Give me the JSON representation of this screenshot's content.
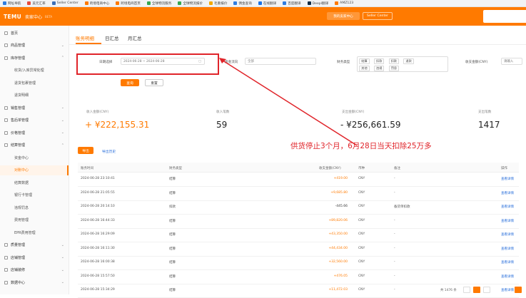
{
  "bookmarks": [
    "网址导航",
    "美元汇率",
    "Seller Center",
    "跨境电商中心",
    "跨境电商首页",
    "全球物流服务",
    "全球物流报价",
    "毛重报价",
    "佣金查询",
    "在线翻译",
    "百度翻译",
    "Deepl翻译",
    "AMZ123"
  ],
  "topbar": {
    "logo": "TEMU",
    "subtitle": "卖家中心",
    "tag": "BETA",
    "btn_a": "我的卖家中心",
    "btn_b": "Seller Center"
  },
  "sidebar": {
    "items": [
      {
        "label": "首页",
        "level": 0,
        "chev": ""
      },
      {
        "label": "商品管理",
        "level": 0,
        "chev": "⌄"
      },
      {
        "label": "库存管理",
        "level": 0,
        "chev": "⌃"
      },
      {
        "label": "收货/入库异常处理",
        "level": 1,
        "chev": ""
      },
      {
        "label": "退货包裹管理",
        "level": 1,
        "chev": ""
      },
      {
        "label": "退货明细",
        "level": 1,
        "chev": ""
      },
      {
        "label": "销售管理",
        "level": 0,
        "chev": "⌄"
      },
      {
        "label": "售后单管理",
        "level": 0,
        "chev": "⌄"
      },
      {
        "label": "价格管理",
        "level": 0,
        "chev": "⌄"
      },
      {
        "label": "结算管理",
        "level": 0,
        "chev": "⌃"
      },
      {
        "label": "资金中心",
        "level": 1,
        "chev": ""
      },
      {
        "label": "对账中心",
        "level": 1,
        "chev": "",
        "active": true
      },
      {
        "label": "结算数据",
        "level": 1,
        "chev": ""
      },
      {
        "label": "银行卡管理",
        "level": 1,
        "chev": ""
      },
      {
        "label": "违规罚息",
        "level": 1,
        "chev": ""
      },
      {
        "label": "费用管理",
        "level": 1,
        "chev": ""
      },
      {
        "label": "EPR费用管理",
        "level": 1,
        "chev": ""
      },
      {
        "label": "质量管理",
        "level": 0,
        "chev": "⌄"
      },
      {
        "label": "店铺管理",
        "level": 0,
        "chev": "⌄"
      },
      {
        "label": "店铺装修",
        "level": 0,
        "chev": "⌄"
      },
      {
        "label": "数据中心",
        "level": 0,
        "chev": "⌄"
      }
    ]
  },
  "tabs": [
    "账务明细",
    "日汇总",
    "月汇总"
  ],
  "filters": {
    "date_label": "日期选择",
    "date_value": "2024-06-28 ~ 2024-06-28",
    "currency_label": "资金流向",
    "currency_value": "全部",
    "type_label": "财务类型",
    "type_chips": [
      "结算",
      "扣款",
      "扣款",
      "退款",
      "其他",
      "违规",
      "罚息"
    ],
    "amount_label": "收支金额(CNY)",
    "amount_placeholder": "请输入"
  },
  "actions": {
    "query": "查询",
    "reset": "重置"
  },
  "stats": [
    {
      "label": "收入金额(CNY)",
      "value": "+ ¥222,155.31",
      "orange": true
    },
    {
      "label": "收入笔数",
      "value": "59",
      "orange": false
    },
    {
      "label": "支出金额(CNY)",
      "value": "- ¥256,661.59",
      "orange": false
    },
    {
      "label": "支出笔数",
      "value": "1417",
      "orange": false
    }
  ],
  "annotation": "供货停止3个月，6月28日当天扣除25万多",
  "table_actions": {
    "export": "导出",
    "history": "导出历史"
  },
  "table": {
    "headers": [
      "账务时间",
      "财务类型",
      "收支金额(CNY)",
      "币种",
      "备注",
      "操作"
    ],
    "rows": [
      {
        "time": "2024-06-28 23:10:41",
        "type": "结算",
        "amount": "+419.00",
        "neg": false,
        "currency": "CNY",
        "note": "-",
        "action": "查看详情"
      },
      {
        "time": "2024-06-28 21:05:55",
        "type": "结算",
        "amount": "+9,685.80",
        "neg": false,
        "currency": "CNY",
        "note": "-",
        "action": "查看详情"
      },
      {
        "time": "2024-06-28 20:14:10",
        "type": "扣款",
        "amount": "-445.66",
        "neg": true,
        "currency": "CNY",
        "note": "备货单扣款",
        "action": "查看详情"
      },
      {
        "time": "2024-06-28 16:44:33",
        "type": "结算",
        "amount": "+89,820.06",
        "neg": false,
        "currency": "CNY",
        "note": "-",
        "action": "查看详情"
      },
      {
        "time": "2024-06-28 16:29:09",
        "type": "结算",
        "amount": "+43,350.00",
        "neg": false,
        "currency": "CNY",
        "note": "-",
        "action": "查看详情"
      },
      {
        "time": "2024-06-28 16:11:30",
        "type": "结算",
        "amount": "+44,434.00",
        "neg": false,
        "currency": "CNY",
        "note": "-",
        "action": "查看详情"
      },
      {
        "time": "2024-06-28 16:00:38",
        "type": "结算",
        "amount": "+32,560.00",
        "neg": false,
        "currency": "CNY",
        "note": "-",
        "action": "查看详情"
      },
      {
        "time": "2024-06-28 15:57:50",
        "type": "结算",
        "amount": "+476.05",
        "neg": false,
        "currency": "CNY",
        "note": "-",
        "action": "查看详情"
      },
      {
        "time": "2024-06-28 15:34:29",
        "type": "结算",
        "amount": "+11,472.03",
        "neg": false,
        "currency": "CNY",
        "note": "-",
        "action": "查看详情"
      }
    ]
  },
  "pager": {
    "total": "共 1476 条"
  },
  "colors": {
    "brand": "#ff7a00",
    "annotation": "#e0242a",
    "link": "#2a6fdb"
  }
}
